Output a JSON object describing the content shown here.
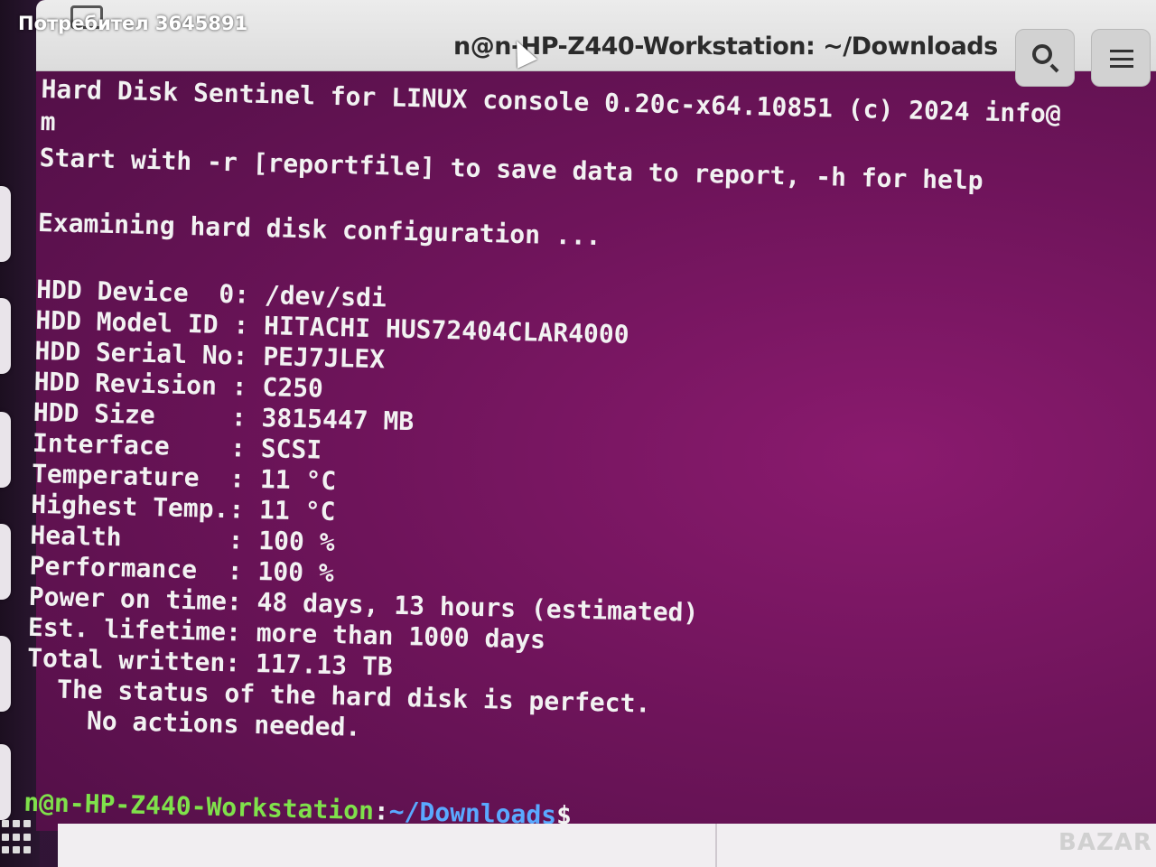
{
  "overlay": {
    "user_label": "Потребител 3645891"
  },
  "window": {
    "title": "n@n-HP-Z440-Workstation: ~/Downloads"
  },
  "terminal": {
    "lines": [
      "Hard Disk Sentinel for LINUX console 0.20c-x64.10851 (c) 2024 info@",
      "m",
      "Start with -r [reportfile] to save data to report, -h for help",
      "",
      "Examining hard disk configuration ...",
      "",
      "HDD Device  0: /dev/sdi",
      "HDD Model ID : HITACHI HUS72404CLAR4000",
      "HDD Serial No: PEJ7JLEX",
      "HDD Revision : C250",
      "HDD Size     : 3815447 MB",
      "Interface    : SCSI",
      "Temperature  : 11 °C",
      "Highest Temp.: 11 °C",
      "Health       : 100 %",
      "Performance  : 100 %",
      "Power on time: 48 days, 13 hours (estimated)",
      "Est. lifetime: more than 1000 days",
      "Total written: 117.13 TB",
      "  The status of the hard disk is perfect.",
      "    No actions needed."
    ],
    "prompt": {
      "host": "n@n-HP-Z440-Workstation",
      "sep": ":",
      "path": "~/Downloads",
      "symbol": "$"
    }
  },
  "watermark": "BAZAR",
  "icons": [
    "search-icon",
    "menu-icon",
    "tab-icon",
    "cursor-icon"
  ]
}
